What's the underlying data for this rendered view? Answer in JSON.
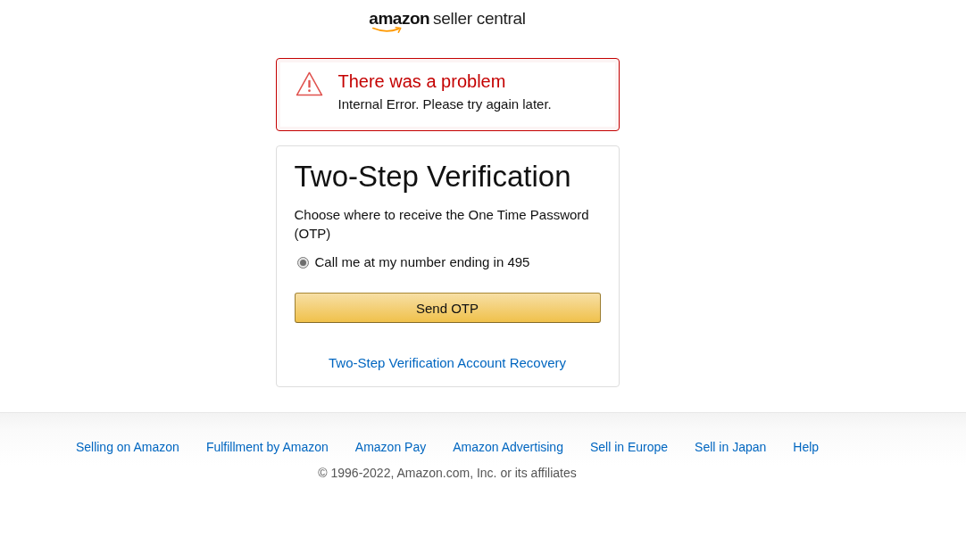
{
  "logo": {
    "brand": "amazon",
    "product": "seller central"
  },
  "alert": {
    "kind": "error",
    "title": "There was a problem",
    "message": "Internal Error. Please try again later."
  },
  "card": {
    "title": "Two-Step Verification",
    "instruction": "Choose where to receive the One Time Password (OTP)",
    "options": [
      {
        "label": "Call me at my number ending in 495",
        "selected": true
      }
    ],
    "button": "Send OTP",
    "recovery_link": "Two-Step Verification Account Recovery"
  },
  "footer": {
    "links": [
      "Selling on Amazon",
      "Fulfillment by Amazon",
      "Amazon Pay",
      "Amazon Advertising",
      "Sell in Europe",
      "Sell in Japan",
      "Help"
    ],
    "copyright": "© 1996-2022, Amazon.com, Inc. or its affiliates"
  }
}
